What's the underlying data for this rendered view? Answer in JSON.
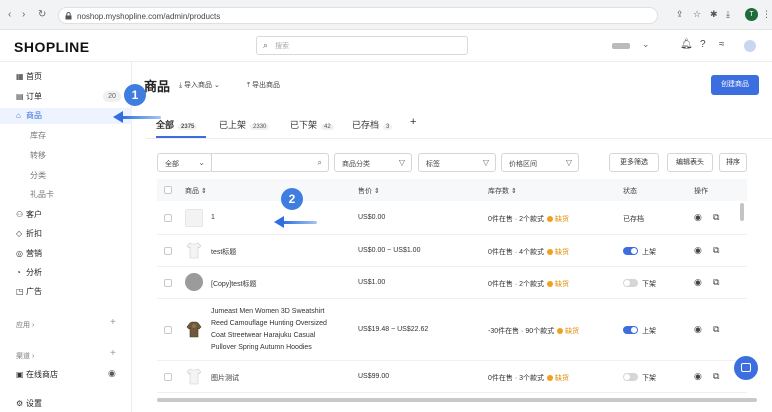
{
  "browser": {
    "url": "noshop.myshopline.com/admin/products"
  },
  "app": {
    "logo": "SHOPLINE",
    "search_placeholder": "搜索"
  },
  "sidebar": {
    "items": [
      {
        "label": "首页",
        "icon": "dashboard-icon"
      },
      {
        "label": "订单",
        "icon": "order-icon",
        "badge": "20"
      },
      {
        "label": "商品",
        "icon": "bag-icon",
        "active": true
      },
      {
        "label": "客户",
        "icon": "user-icon"
      },
      {
        "label": "折扣",
        "icon": "tag-icon"
      },
      {
        "label": "营销",
        "icon": "marketing-icon"
      },
      {
        "label": "分析",
        "icon": "analytics-icon"
      },
      {
        "label": "广告",
        "icon": "ads-icon"
      }
    ],
    "sub_items": [
      "库存",
      "转移",
      "分类",
      "礼品卡"
    ],
    "group_apps": "应用",
    "group_channels": "渠道",
    "online_store": "在线商店",
    "settings": "设置"
  },
  "main": {
    "title": "商品",
    "import": "导入商品",
    "export": "导出商品",
    "create": "创建商品",
    "tabs": [
      {
        "label": "全部",
        "count": "2375"
      },
      {
        "label": "已上架",
        "count": "2330"
      },
      {
        "label": "已下架",
        "count": "42"
      },
      {
        "label": "已存档",
        "count": "3"
      }
    ],
    "add_tab": "+",
    "filters": {
      "all": "全部",
      "category": "商品分类",
      "tags": "标签",
      "price": "价格区间",
      "more": "更多筛选",
      "edit_columns": "编辑表头",
      "sort": "排序"
    },
    "columns": {
      "product": "商品",
      "price": "售价",
      "inventory": "库存数",
      "status": "状态",
      "actions": "操作"
    },
    "rows": [
      {
        "name": "1",
        "price": "US$0.00",
        "inventory": "0件在售 · 2个款式",
        "warn": "缺货",
        "status": "已存档"
      },
      {
        "name": "test标题",
        "price": "US$0.00 ~ US$1.00",
        "inventory": "0件在售 · 4个款式",
        "warn": "缺货",
        "status": "上架"
      },
      {
        "name": "[Copy]test标题",
        "price": "US$1.00",
        "inventory": "0件在售 · 2个款式",
        "warn": "缺货",
        "status": "下架"
      },
      {
        "name_lines": [
          "Jumeast Men Women 3D Sweatshirt",
          "Reed Camouflage Hunting Oversized",
          "Coat Streetwear Harajuku Casual",
          "Pullover Spring Autumn Hoodies"
        ],
        "price": "US$19.48 ~ US$22.62",
        "inventory": "-30件在售 · 90个款式",
        "warn": "缺货",
        "status": "上架"
      },
      {
        "name": "图片测试",
        "price": "US$99.00",
        "inventory": "0件在售 · 3个款式",
        "warn": "缺货",
        "status": "下架"
      }
    ]
  },
  "annotations": {
    "step1": "1",
    "step2": "2"
  },
  "colors": {
    "accent": "#3c6ee0",
    "warning": "#f0a020"
  }
}
